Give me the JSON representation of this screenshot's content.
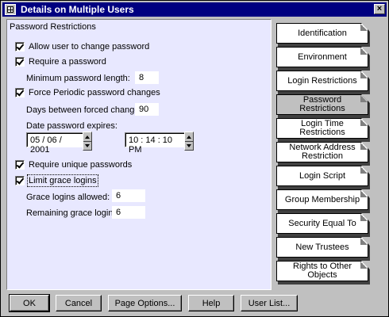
{
  "window": {
    "title": "Details on Multiple Users",
    "close_glyph": "×"
  },
  "panel": {
    "title": "Password Restrictions",
    "allow_change": {
      "label": "Allow user to change password",
      "checked": true
    },
    "require_password": {
      "label": "Require a password",
      "checked": true
    },
    "min_length": {
      "label": "Minimum password length:",
      "value": "8"
    },
    "force_periodic": {
      "label": "Force Periodic password changes",
      "checked": true
    },
    "days_between": {
      "label": "Days between forced changes:",
      "value": "90"
    },
    "expires": {
      "label": "Date password expires:",
      "date": "05 / 06 / 2001",
      "time": "10 : 14 : 10 PM"
    },
    "require_unique": {
      "label": "Require unique passwords",
      "checked": true
    },
    "limit_grace": {
      "label": "Limit grace logins",
      "checked": true
    },
    "grace_allowed": {
      "label": "Grace logins allowed:",
      "value": "6"
    },
    "grace_remaining": {
      "label": "Remaining grace logins:",
      "value": "6"
    }
  },
  "pages": [
    "Identification",
    "Environment",
    "Login Restrictions",
    "Password Restrictions",
    "Login Time Restrictions",
    "Network Address Restriction",
    "Login Script",
    "Group Membership",
    "Security Equal To",
    "New Trustees",
    "Rights to Other Objects"
  ],
  "active_page": "Password Restrictions",
  "buttons": {
    "ok": "OK",
    "cancel": "Cancel",
    "page_options": "Page Options...",
    "help": "Help",
    "user_list": "User List..."
  }
}
